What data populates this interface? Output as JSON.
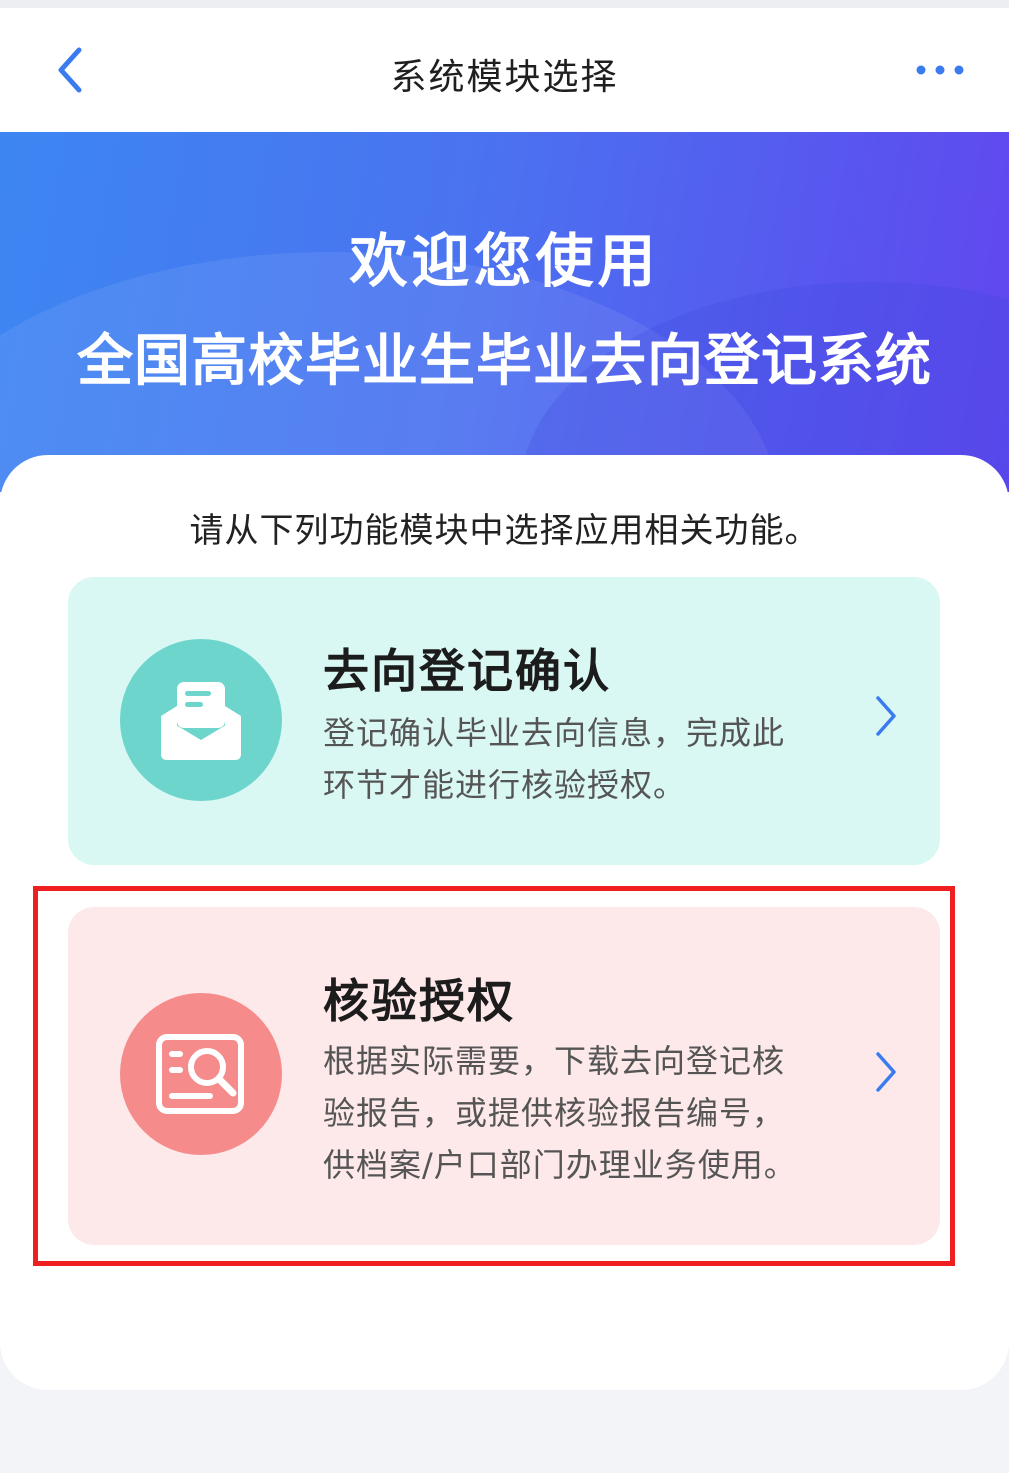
{
  "header": {
    "title": "系统模块选择",
    "back_icon": "chevron-left-icon",
    "more_icon": "more-dots-icon",
    "accent": "#3a7cf0"
  },
  "hero": {
    "line1": "欢迎您使用",
    "line2": "全国高校毕业生毕业去向登记系统",
    "gradient_start": "#3d86f2",
    "gradient_end": "#6246ef"
  },
  "panel": {
    "intro": "请从下列功能模块中选择应用相关功能。"
  },
  "modules": [
    {
      "title": "去向登记确认",
      "desc_line1": "登记确认毕业去向信息，完成此",
      "desc_line2": "环节才能进行核验授权。",
      "icon": "open-envelope-icon",
      "card_color": "#d9f7f3",
      "icon_color": "#6dd5cc"
    },
    {
      "title": "核验授权",
      "desc_line1": "根据实际需要，下载去向登记核",
      "desc_line2": "验报告，或提供核验报告编号，",
      "desc_line3": "供档案/户口部门办理业务使用。",
      "icon": "document-search-icon",
      "card_color": "#fde9ea",
      "icon_color": "#f58b8b"
    }
  ],
  "highlight_color": "#ef1f1f"
}
